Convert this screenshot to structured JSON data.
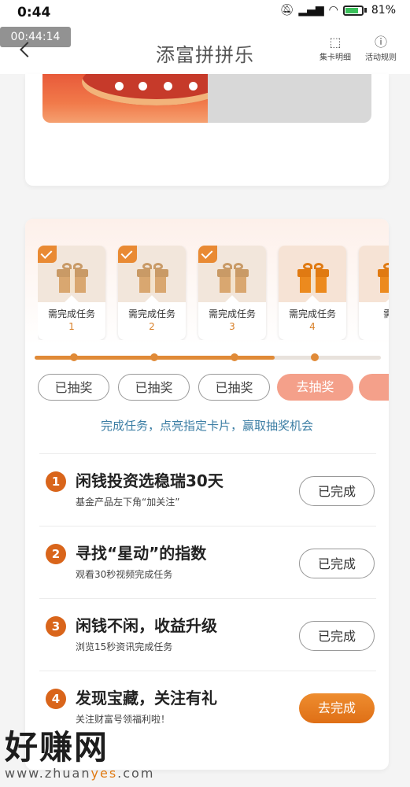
{
  "status_bar": {
    "time": "0:44",
    "battery": "81%"
  },
  "timer_badge": "00:44:14",
  "header": {
    "title": "添富拼拼乐",
    "card_detail_label": "集卡明细",
    "rules_label": "活动规则"
  },
  "gift_cards": [
    {
      "label": "需完成任务",
      "num": "1",
      "checked": true
    },
    {
      "label": "需完成任务",
      "num": "2",
      "checked": true
    },
    {
      "label": "需完成任务",
      "num": "3",
      "checked": true
    },
    {
      "label": "需完成任务",
      "num": "4",
      "checked": false
    },
    {
      "label": "需完",
      "num": "",
      "checked": false
    }
  ],
  "progress": {
    "completed_steps": 3,
    "total_steps": 4
  },
  "draw_buttons": [
    {
      "label": "已抽奖",
      "state": "done"
    },
    {
      "label": "已抽奖",
      "state": "done"
    },
    {
      "label": "已抽奖",
      "state": "done"
    },
    {
      "label": "去抽奖",
      "state": "go"
    },
    {
      "label": "去",
      "state": "go"
    }
  ],
  "hint": "完成任务，点亮指定卡片，赢取抽奖机会",
  "tasks": [
    {
      "num": "1",
      "title": "闲钱投资选稳瑞30天",
      "subtitle": "基金产品左下角“加关注”",
      "button": "已完成",
      "state": "done"
    },
    {
      "num": "2",
      "title": "寻找“星动”的指数",
      "subtitle": "观看30秒视频完成任务",
      "button": "已完成",
      "state": "done"
    },
    {
      "num": "3",
      "title": "闲钱不闲，收益升级",
      "subtitle": "浏览15秒资讯完成任务",
      "button": "已完成",
      "state": "done"
    },
    {
      "num": "4",
      "title": "发现宝藏，关注有礼",
      "subtitle": "关注财富号领福利啦！",
      "button": "去完成",
      "state": "todo"
    }
  ],
  "watermark": {
    "logo": "好赚网",
    "url_pre": "www.zhuan",
    "url_hl": "yes",
    "url_post": ".com"
  },
  "colors": {
    "accent_orange": "#e08a37",
    "hint_blue": "#3c7ea4",
    "task_num": "#d9651b"
  }
}
